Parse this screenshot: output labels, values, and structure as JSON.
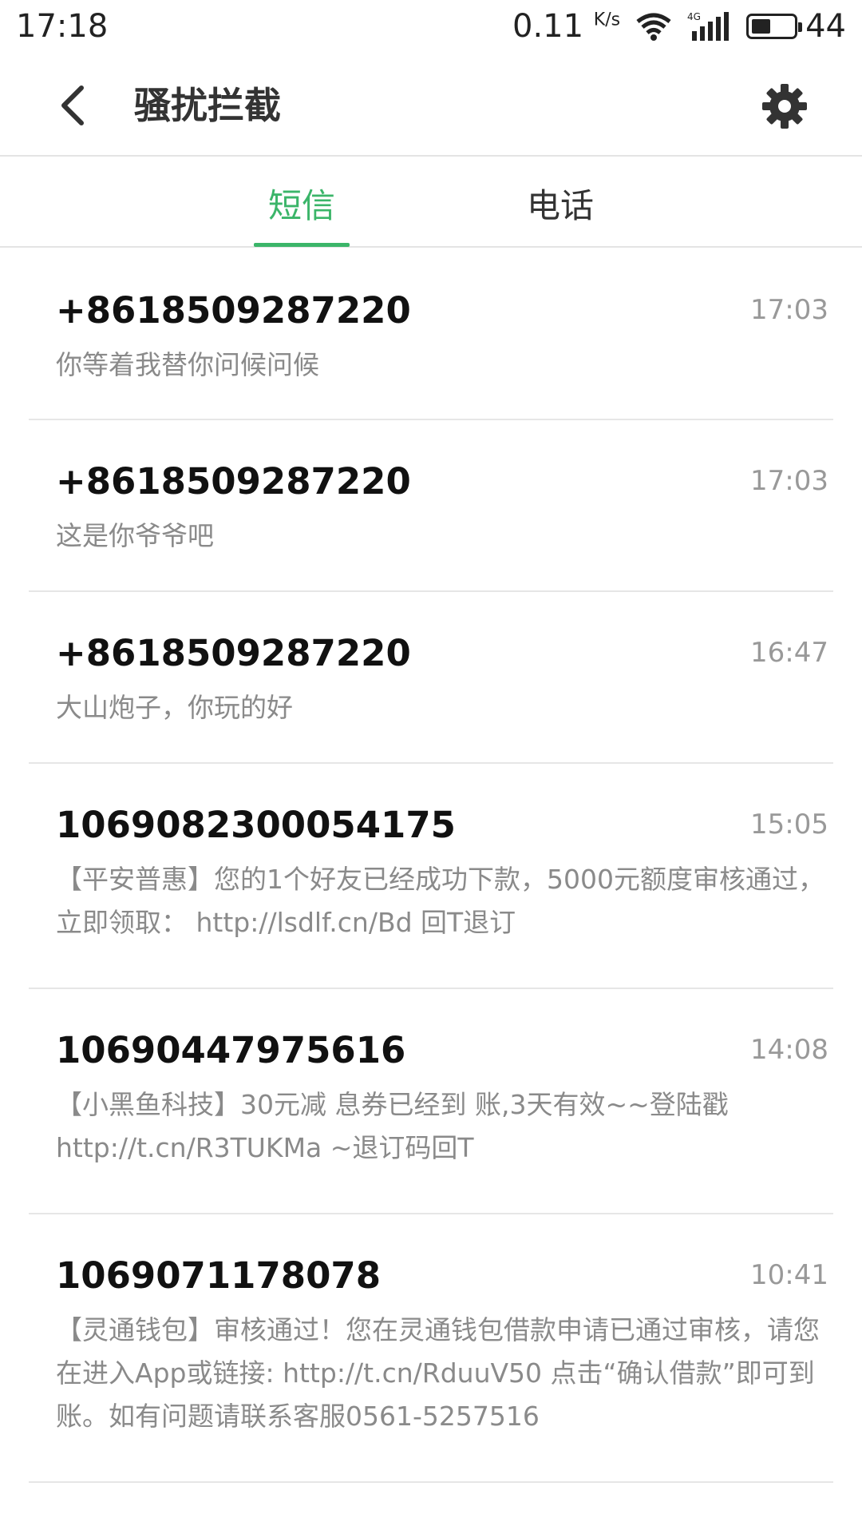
{
  "status_bar": {
    "time": "17:18",
    "net_speed": "0.11",
    "net_unit": "K/s",
    "network_type": "4G",
    "battery_level": "44",
    "battery_fraction": 0.44
  },
  "header": {
    "title": "骚扰拦截",
    "back_icon": "chevron-left-icon",
    "settings_icon": "gear-icon"
  },
  "tabs": [
    {
      "label": "短信",
      "active": true
    },
    {
      "label": "电话",
      "active": false
    }
  ],
  "accent_color": "#3bb569",
  "messages": [
    {
      "sender": "+8618509287220",
      "time": "17:03",
      "body": "你等着我替你问候问候"
    },
    {
      "sender": "+8618509287220",
      "time": "17:03",
      "body": "这是你爷爷吧"
    },
    {
      "sender": "+8618509287220",
      "time": "16:47",
      "body": "大山炮子，你玩的好"
    },
    {
      "sender": "1069082300054175",
      "time": "15:05",
      "body": "【平安普惠】您的1个好友已经成功下款，5000元额度审核通过，立即领取： http://lsdlf.cn/Bd 回T退订"
    },
    {
      "sender": "10690447975616",
      "time": "14:08",
      "body": "【小黑鱼科技】30元减 息券已经到 账,3天有效~~登陆戳 http://t.cn/R3TUKMa ~退订码回T"
    },
    {
      "sender": "1069071178078",
      "time": "10:41",
      "body": "【灵通钱包】审核通过！您在灵通钱包借款申请已通过审核，请您在进入App或链接: http://t.cn/RduuV50 点击“确认借款”即可到账。如有问题请联系客服0561-5257516"
    }
  ]
}
